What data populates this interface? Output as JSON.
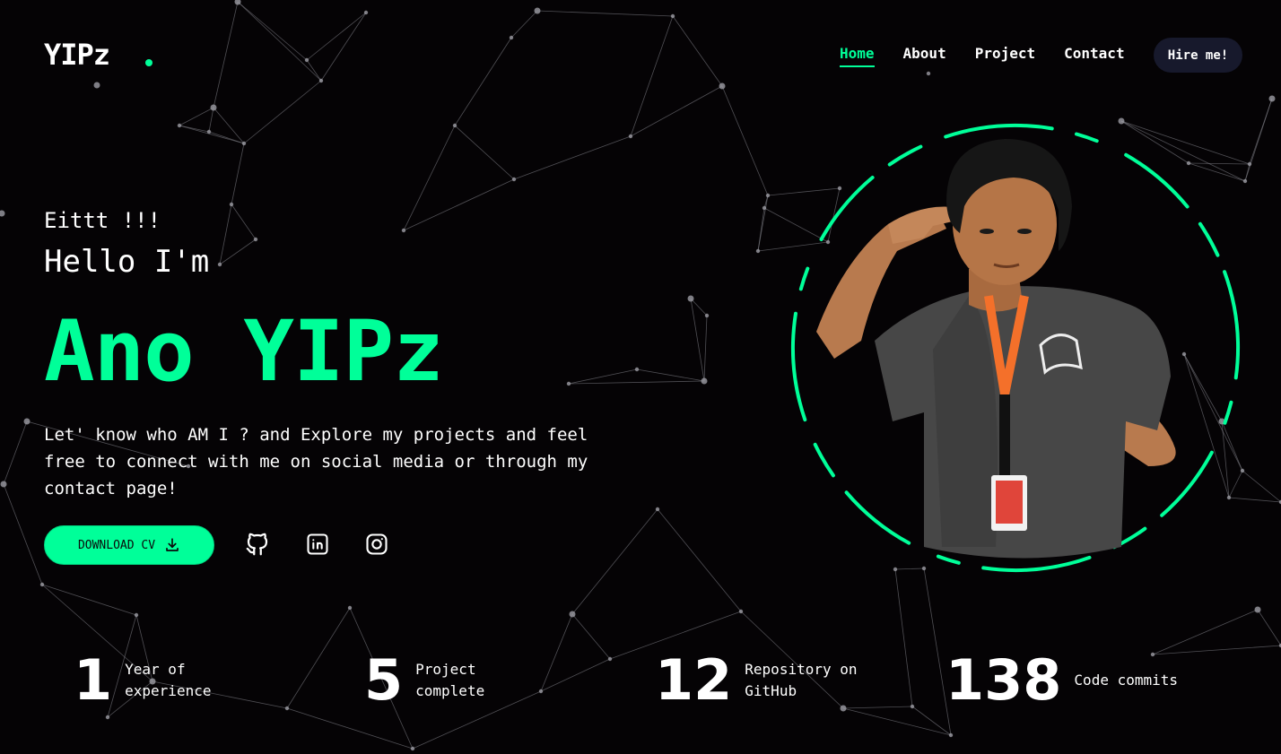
{
  "brand": {
    "logo_text": "YIPz",
    "accent_color": "#00ff99"
  },
  "nav": {
    "items": [
      {
        "label": "Home",
        "active": true
      },
      {
        "label": "About",
        "active": false
      },
      {
        "label": "Project",
        "active": false
      },
      {
        "label": "Contact",
        "active": false
      }
    ],
    "hire_label": "Hire me!"
  },
  "hero": {
    "greeting": "Eittt !!!",
    "hello": "Hello I'm",
    "name": "Ano YIPz",
    "description": "Let' know who AM I ? and Explore my projects and feel free to connect with me on social media or through my contact page!",
    "cv_button_label": "DOWNLOAD CV",
    "cv_icon": "download-icon"
  },
  "social": [
    {
      "name": "github",
      "icon": "github-icon"
    },
    {
      "name": "linkedin",
      "icon": "linkedin-icon"
    },
    {
      "name": "instagram",
      "icon": "instagram-icon"
    }
  ],
  "stats": [
    {
      "number": "1",
      "label": "Year of experience"
    },
    {
      "number": "5",
      "label": "Project complete"
    },
    {
      "number": "12",
      "label": "Repository on GitHub"
    },
    {
      "number": "138",
      "label": "Code commits"
    }
  ]
}
